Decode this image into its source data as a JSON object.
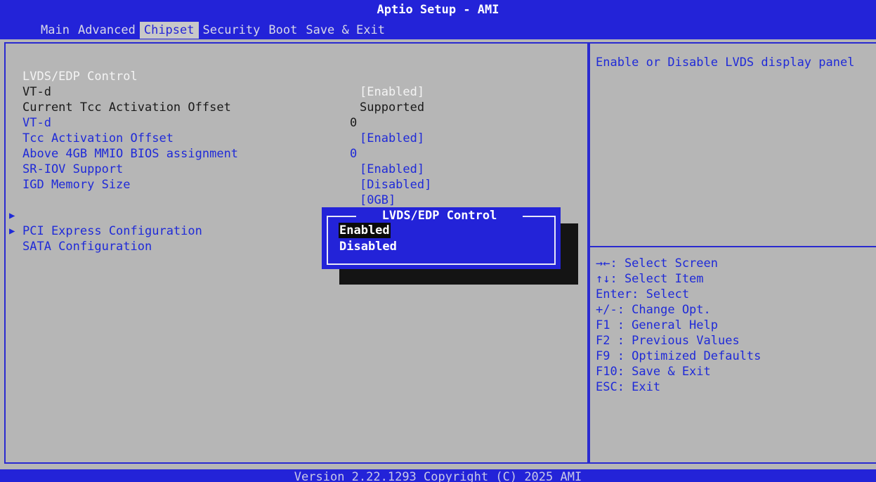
{
  "header": {
    "title": "Aptio Setup - AMI",
    "tabs": [
      "Main",
      "Advanced",
      "Chipset",
      "Security",
      "Boot",
      "Save & Exit"
    ],
    "active_tab": "Chipset"
  },
  "settings": [
    {
      "label": "LVDS/EDP Control",
      "value": "[Enabled]"
    },
    {
      "label": "VT-d",
      "value": "Supported"
    },
    {
      "label": "Current Tcc Activation Offset",
      "value": "0"
    },
    {
      "label": "VT-d",
      "value": "[Enabled]"
    },
    {
      "label": "Tcc Activation Offset",
      "value": "0"
    },
    {
      "label": "Above 4GB MMIO BIOS assignment",
      "value": "[Enabled]"
    },
    {
      "label": "SR-IOV Support",
      "value": "[Disabled]"
    },
    {
      "label": "IGD Memory Size",
      "value": "[0GB]"
    }
  ],
  "submenus": [
    {
      "label": "PCI Express Configuration"
    },
    {
      "label": "SATA Configuration"
    }
  ],
  "help": {
    "description": "Enable or Disable LVDS display panel",
    "keys": [
      "→←: Select Screen",
      "↑↓: Select Item",
      "Enter: Select",
      "+/-: Change Opt.",
      "F1 : General Help",
      "F2 : Previous Values",
      "F9 : Optimized Defaults",
      "F10: Save & Exit",
      "ESC: Exit"
    ]
  },
  "popup": {
    "title": "LVDS/EDP Control",
    "options": [
      "Enabled",
      "Disabled"
    ],
    "selected": "Enabled"
  },
  "footer": {
    "text": "Version 2.22.1293 Copyright (C) 2025 AMI"
  },
  "colors": {
    "bios_blue": "#2323d8",
    "panel_gray": "#b6b6b6",
    "highlight_text": "#f4f4f4"
  }
}
